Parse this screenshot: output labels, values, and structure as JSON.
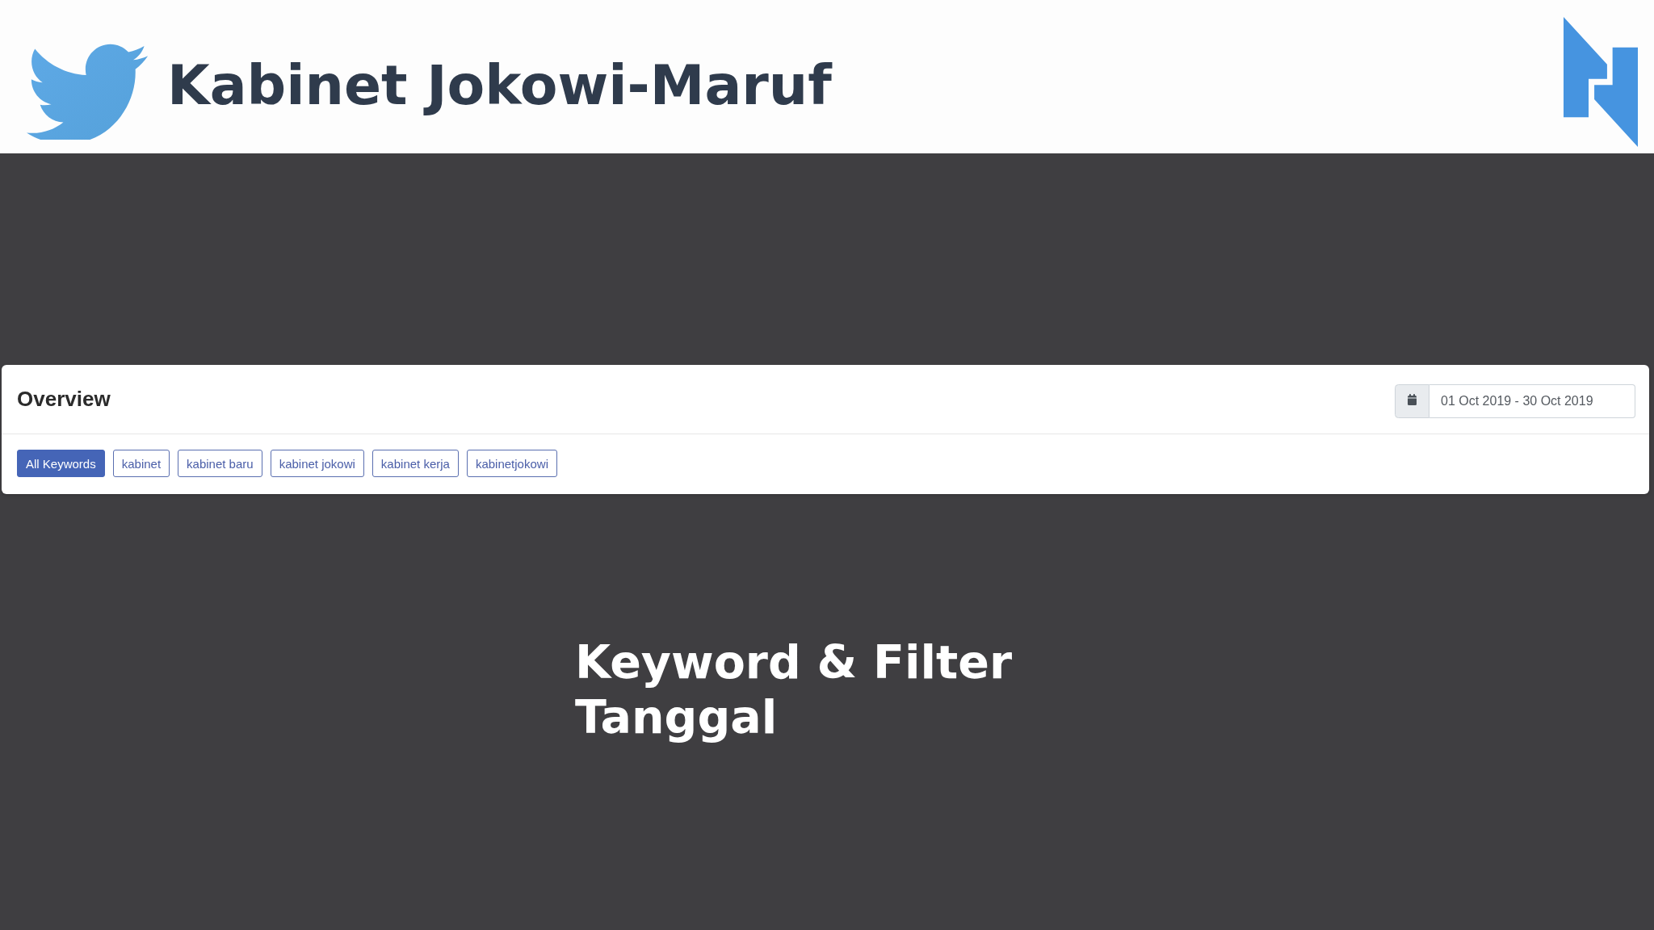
{
  "header": {
    "title": "Kabinet Jokowi-Maruf"
  },
  "overview": {
    "title": "Overview",
    "date_range": {
      "value": "01 Oct 2019 - 30 Oct 2019"
    },
    "keywords": [
      {
        "label": "All Keywords",
        "selected": true
      },
      {
        "label": "kabinet",
        "selected": false
      },
      {
        "label": "kabinet baru",
        "selected": false
      },
      {
        "label": "kabinet jokowi",
        "selected": false
      },
      {
        "label": "kabinet kerja",
        "selected": false
      },
      {
        "label": "kabinetjokowi",
        "selected": false
      }
    ]
  },
  "caption": {
    "text": "Keyword & Filter Tanggal"
  }
}
